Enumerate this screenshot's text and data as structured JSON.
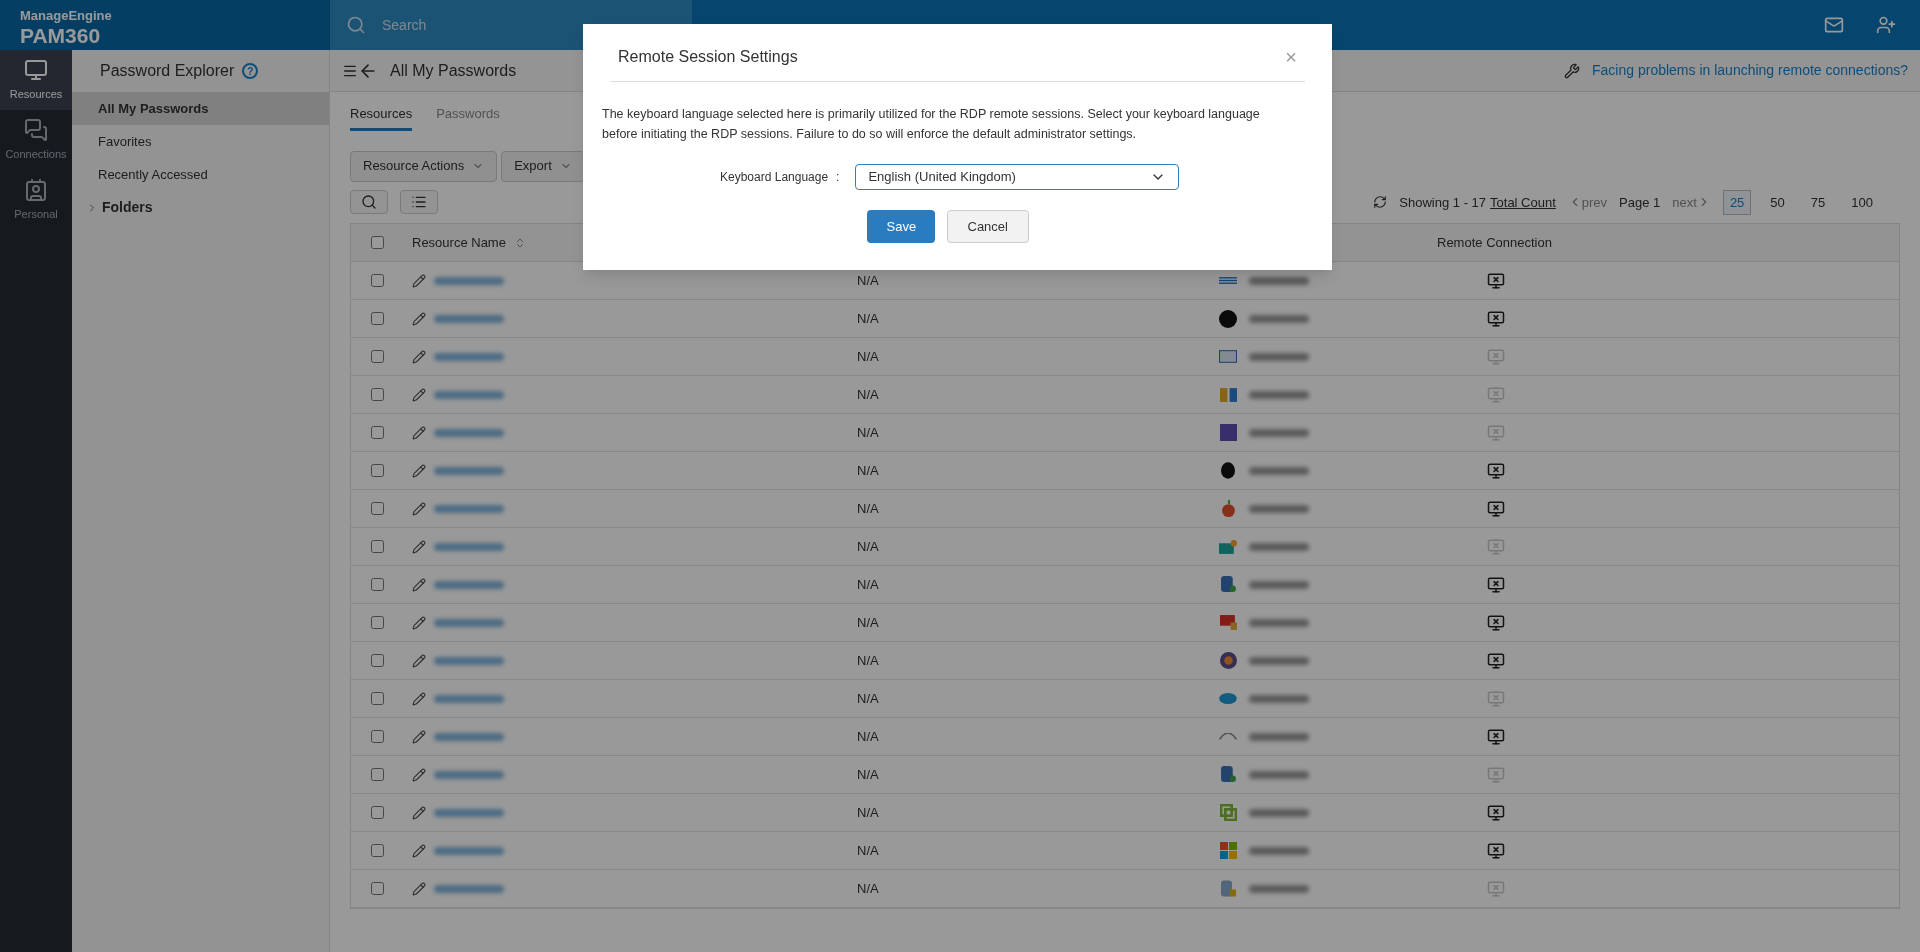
{
  "header": {
    "brand": "ManageEngine",
    "product": "PAM360",
    "search_placeholder": "Search"
  },
  "rail": [
    {
      "label": "Resources",
      "selected": true,
      "kind": "monitor"
    },
    {
      "label": "Connections",
      "selected": false,
      "kind": "connections"
    },
    {
      "label": "Personal",
      "selected": false,
      "kind": "personal"
    }
  ],
  "sidebar": {
    "title": "Password Explorer",
    "help_icon": "?",
    "items": [
      {
        "label": "All My Passwords",
        "selected": true
      },
      {
        "label": "Favorites",
        "selected": false
      },
      {
        "label": "Recently Accessed",
        "selected": false
      }
    ],
    "folders": {
      "label": "Folders",
      "expanded": false
    }
  },
  "main": {
    "title": "All My Passwords",
    "help_link": "Facing problems in launching remote connections?",
    "tabs": [
      {
        "label": "Resources",
        "selected": true
      },
      {
        "label": "Passwords",
        "selected": false
      }
    ],
    "actions": [
      "Resource Actions",
      "Export"
    ],
    "pagination": {
      "showing": "Showing 1 - 17",
      "total": "Total Count",
      "prev": "prev",
      "page": "Page 1",
      "next": "next",
      "sizes": [
        {
          "label": "25",
          "selected": true
        },
        {
          "label": "50",
          "selected": false
        },
        {
          "label": "75",
          "selected": false
        },
        {
          "label": "100",
          "selected": false
        }
      ]
    }
  },
  "table": {
    "select_all": {
      "checked": false
    },
    "columns": [
      "Resource Name",
      "Remote Connection"
    ],
    "rows": [
      {
        "checked": false,
        "description": "N/A",
        "type_icon": {
          "kind": "ibm"
        },
        "remote_enabled": true
      },
      {
        "checked": false,
        "description": "N/A",
        "type_icon": {
          "kind": "hp"
        },
        "remote_enabled": true
      },
      {
        "checked": false,
        "description": "N/A",
        "type_icon": {
          "kind": "card"
        },
        "remote_enabled": false
      },
      {
        "checked": false,
        "description": "N/A",
        "type_icon": {
          "kind": "ldap"
        },
        "remote_enabled": false
      },
      {
        "checked": false,
        "description": "N/A",
        "type_icon": {
          "kind": "license"
        },
        "remote_enabled": false
      },
      {
        "checked": false,
        "description": "N/A",
        "type_icon": {
          "kind": "linux"
        },
        "remote_enabled": true
      },
      {
        "checked": false,
        "description": "N/A",
        "type_icon": {
          "kind": "apple"
        },
        "remote_enabled": true
      },
      {
        "checked": false,
        "description": "N/A",
        "type_icon": {
          "kind": "azure"
        },
        "remote_enabled": false
      },
      {
        "checked": false,
        "description": "N/A",
        "type_icon": {
          "kind": "database"
        },
        "remote_enabled": true
      },
      {
        "checked": false,
        "description": "N/A",
        "type_icon": {
          "kind": "oracle"
        },
        "remote_enabled": true
      },
      {
        "checked": false,
        "description": "N/A",
        "type_icon": {
          "kind": "firewall"
        },
        "remote_enabled": true
      },
      {
        "checked": false,
        "description": "N/A",
        "type_icon": {
          "kind": "cloud"
        },
        "remote_enabled": false
      },
      {
        "checked": false,
        "description": "N/A",
        "type_icon": {
          "kind": "solaris"
        },
        "remote_enabled": true
      },
      {
        "checked": false,
        "description": "N/A",
        "type_icon": {
          "kind": "database"
        },
        "remote_enabled": false
      },
      {
        "checked": false,
        "description": "N/A",
        "type_icon": {
          "kind": "vmware"
        },
        "remote_enabled": true
      },
      {
        "checked": false,
        "description": "N/A",
        "type_icon": {
          "kind": "windows"
        },
        "remote_enabled": true
      },
      {
        "checked": false,
        "description": "N/A",
        "type_icon": {
          "kind": "dbserver"
        },
        "remote_enabled": false
      }
    ]
  },
  "dialog": {
    "title": "Remote Session Settings",
    "close": "×",
    "message": "The keyboard language selected here is primarily utilized for the RDP remote sessions. Select your keyboard language before initiating the RDP sessions. Failure to do so will enforce the default administrator settings.",
    "field_label": "Keyboard Language",
    "separator": ":",
    "value": "English (United Kingdom)",
    "buttons": [
      "Save",
      "Cancel"
    ]
  }
}
